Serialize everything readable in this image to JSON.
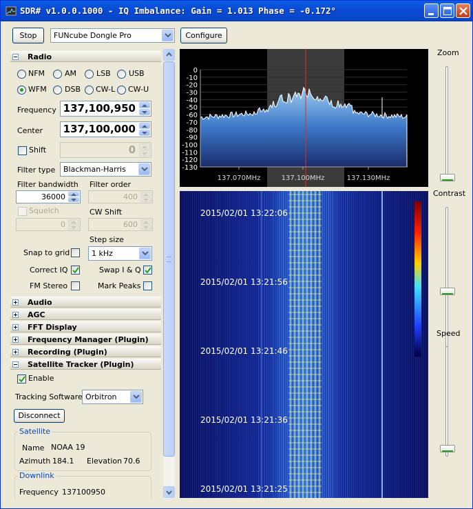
{
  "window": {
    "title": "SDR# v1.0.0.1000 - IQ Imbalance: Gain = 1.013 Phase = -0.172°"
  },
  "toolbar": {
    "stop_label": "Stop",
    "device": "FUNcube Dongle Pro",
    "configure_label": "Configure"
  },
  "radio": {
    "header": "Radio",
    "modes": [
      "NFM",
      "AM",
      "LSB",
      "USB",
      "WFM",
      "DSB",
      "CW-L",
      "CW-U"
    ],
    "selected_mode": "WFM",
    "frequency_label": "Frequency",
    "frequency": "137,100,950",
    "center_label": "Center",
    "center": "137,100,000",
    "shift_label": "Shift",
    "shift": "0",
    "filter_type_label": "Filter type",
    "filter_type": "Blackman-Harris",
    "filter_bandwidth_label": "Filter bandwidth",
    "filter_bandwidth": "36000",
    "filter_order_label": "Filter order",
    "filter_order": "400",
    "squelch_label": "Squelch",
    "squelch": "0",
    "cw_shift_label": "CW Shift",
    "cw_shift": "600",
    "step_size_label": "Step size",
    "step_size": "1 kHz",
    "snap_label": "Snap to grid",
    "correct_iq_label": "Correct IQ",
    "swap_iq_label": "Swap I & Q",
    "fm_stereo_label": "FM Stereo",
    "mark_peaks_label": "Mark Peaks"
  },
  "sections": [
    "Audio",
    "AGC",
    "FFT Display",
    "Frequency Manager (Plugin)",
    "Recording (Plugin)"
  ],
  "satellite_tracker": {
    "header": "Satellite Tracker (Plugin)",
    "enable_label": "Enable",
    "tracking_software_label": "Tracking Software",
    "tracking_software": "Orbitron",
    "disconnect_label": "Disconnect",
    "satellite_group": "Satellite",
    "name_label": "Name",
    "name": "NOAA 19",
    "azimuth_label": "Azimuth",
    "azimuth": "184.1",
    "elevation_label": "Elevation",
    "elevation": "70.6",
    "downlink_group": "Downlink",
    "downlink_frequency_label": "Frequency",
    "downlink_frequency": "137100950"
  },
  "spectrum": {
    "db_ticks": [
      "0",
      "-10",
      "-20",
      "-30",
      "-40",
      "-50",
      "-60",
      "-70",
      "-80",
      "-90",
      "-100",
      "-110",
      "-120",
      "-130"
    ],
    "freq_ticks": [
      "137.070MHz",
      "137.100MHz",
      "137.130MHz"
    ],
    "accent_color": "#e03020"
  },
  "waterfall": {
    "timestamps": [
      "2015/02/01 13:22:06",
      "2015/02/01 13:21:56",
      "2015/02/01 13:21:46",
      "2015/02/01 13:21:36",
      "2015/02/01 13:21:25"
    ]
  },
  "sliders": {
    "zoom_label": "Zoom",
    "zoom_level": 0.0,
    "contrast_label": "Contrast",
    "contrast_level": 0.5,
    "speed_label": "Speed",
    "speed_level": 0.0
  },
  "icons": {
    "app": "sdr-app-icon",
    "minimize": "minimize-icon",
    "maximize": "maximize-icon",
    "close": "close-icon"
  }
}
